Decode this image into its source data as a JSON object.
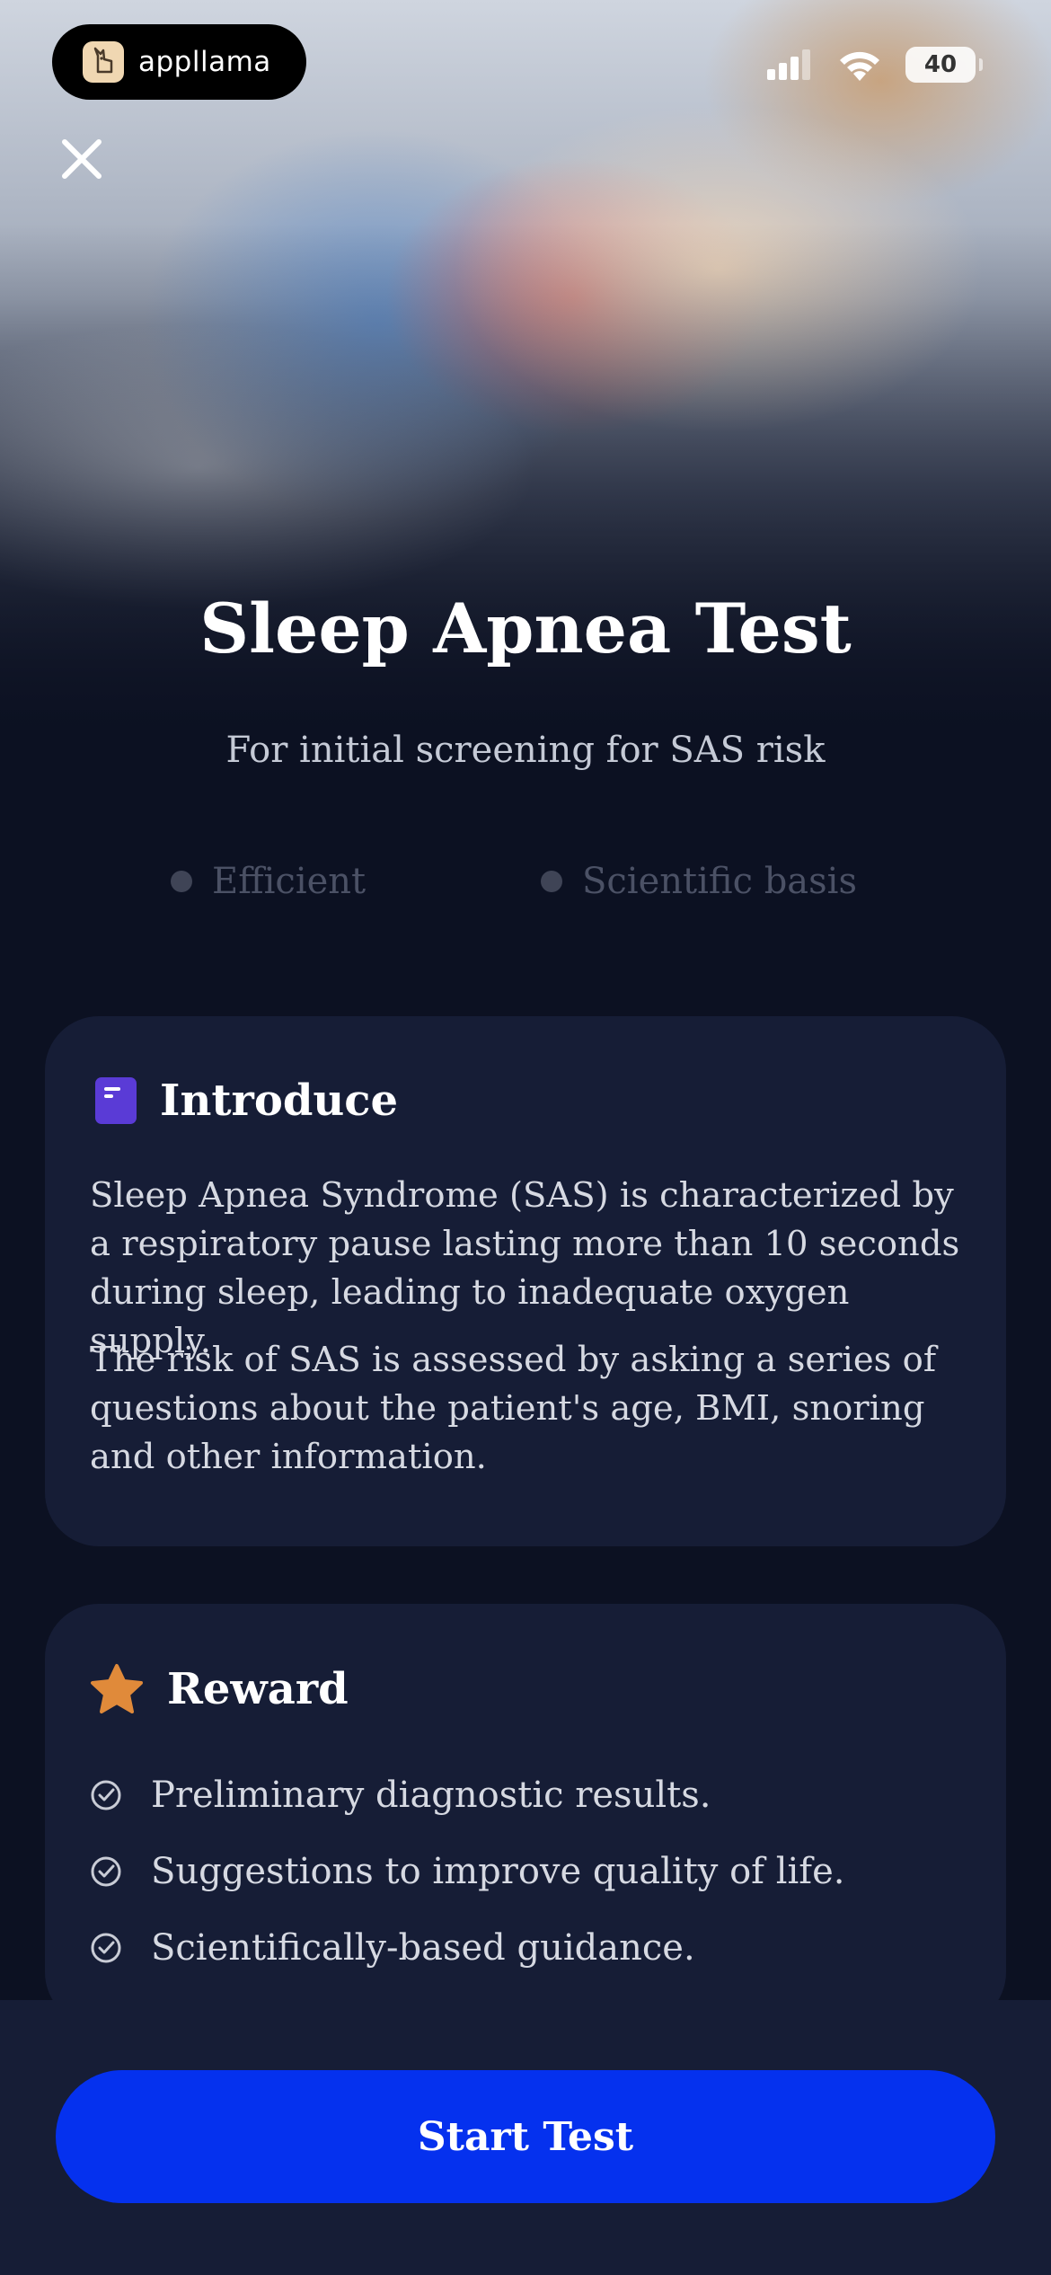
{
  "status_bar": {
    "app_pill": {
      "brand": "appllama"
    },
    "battery": "40"
  },
  "hero": {
    "title": "Sleep Apnea Test",
    "subtitle": "For initial screening for SAS risk"
  },
  "features": [
    "Efficient",
    "Scientific basis"
  ],
  "introduce": {
    "title": "Introduce",
    "paragraphs": [
      "Sleep Apnea Syndrome (SAS) is characterized by a respiratory pause lasting more than 10 seconds during sleep, leading to inadequate oxygen supply.",
      "The risk of SAS is assessed by asking a series of questions about the patient's age, BMI, snoring and other information."
    ]
  },
  "reward": {
    "title": "Reward",
    "items": [
      "Preliminary diagnostic results.",
      "Suggestions to improve quality of life.",
      "Scientifically-based guidance."
    ]
  },
  "cta": {
    "label": "Start Test"
  },
  "colors": {
    "background": "#0c1122",
    "card": "#161d36",
    "primary_button": "#0531ee",
    "introduce_icon": "#5a3bd6",
    "reward_star": "#e08a3a"
  },
  "icons": {
    "close": "close-icon",
    "introduce": "document-icon",
    "reward": "star-icon",
    "check": "check-circle-icon",
    "signal": "cellular-signal-icon",
    "wifi": "wifi-icon",
    "battery": "battery-icon"
  }
}
